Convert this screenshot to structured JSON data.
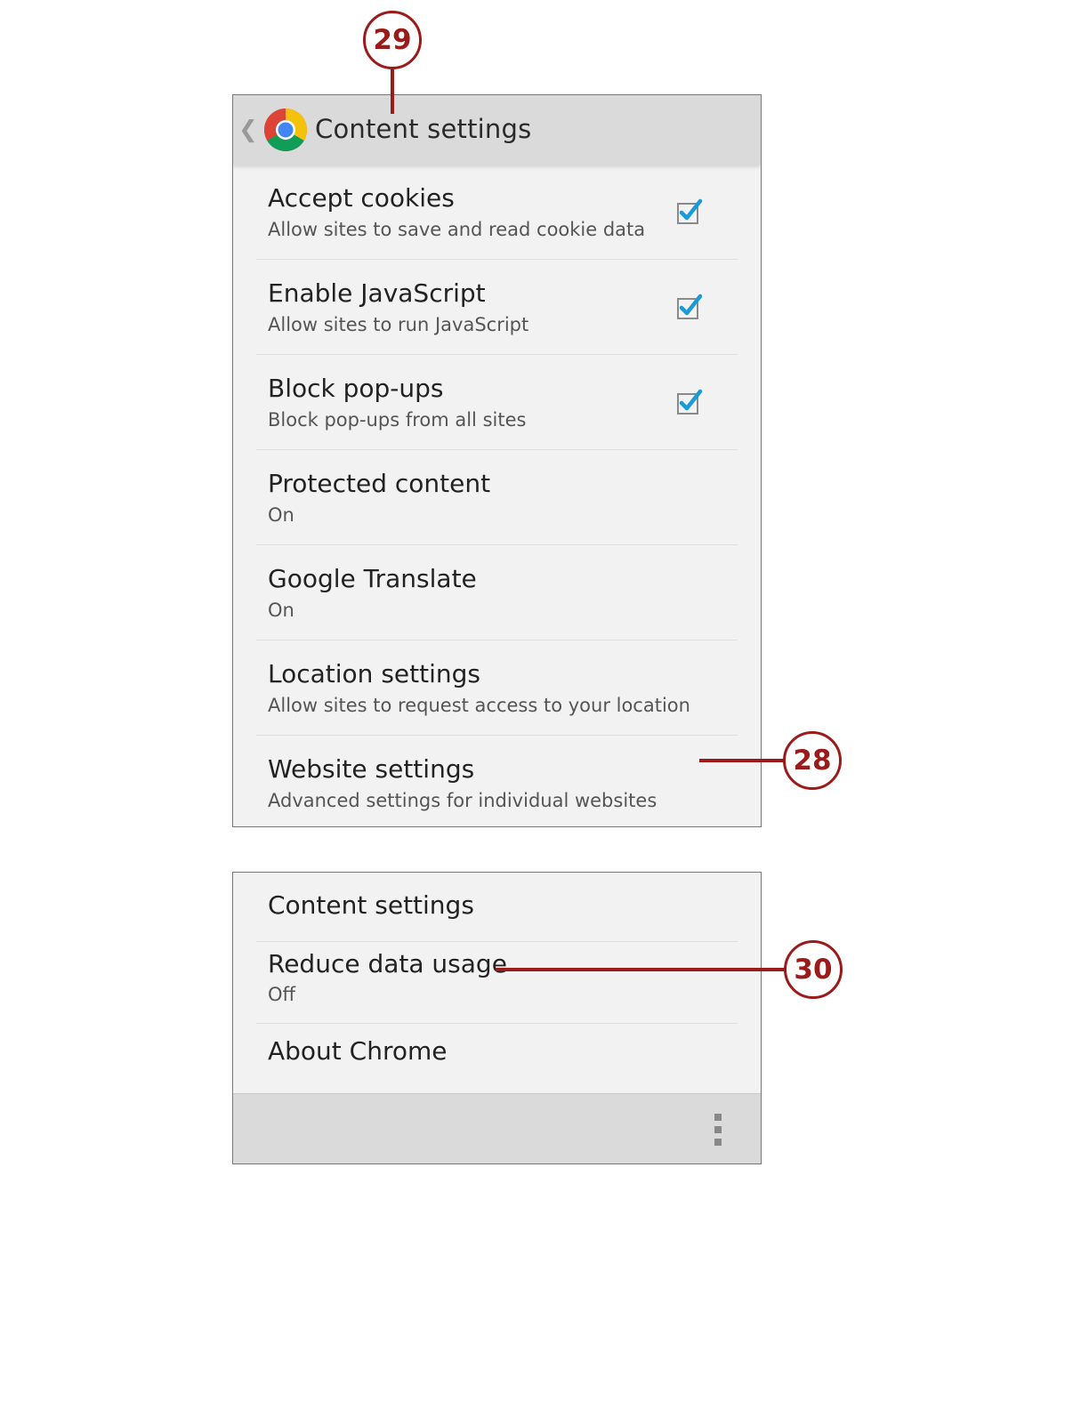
{
  "top_screen": {
    "back_icon": "chevron-left-icon",
    "app_icon": "chrome-logo-icon",
    "title": "Content settings",
    "items": [
      {
        "title": "Accept cookies",
        "summary": "Allow sites to save and read cookie data",
        "checked": true
      },
      {
        "title": "Enable JavaScript",
        "summary": "Allow sites to run JavaScript",
        "checked": true
      },
      {
        "title": "Block pop-ups",
        "summary": "Block pop-ups from all sites",
        "checked": true
      },
      {
        "title": "Protected content",
        "summary": "On"
      },
      {
        "title": "Google Translate",
        "summary": "On"
      },
      {
        "title": "Location settings",
        "summary": "Allow sites to request access to your location"
      },
      {
        "title": "Website settings",
        "summary": "Advanced settings for individual websites"
      }
    ]
  },
  "bottom_screen": {
    "items": [
      {
        "title": "Content settings"
      },
      {
        "title": "Reduce data usage",
        "summary": "Off"
      },
      {
        "title": "About Chrome"
      }
    ],
    "menu_icon": "overflow-menu-icon"
  },
  "callouts": {
    "c28": "28",
    "c29": "29",
    "c30": "30"
  },
  "colors": {
    "callout": "#9b1b1b",
    "checkbox_check": "#1a9bd7",
    "actionbar": "#dadada"
  }
}
